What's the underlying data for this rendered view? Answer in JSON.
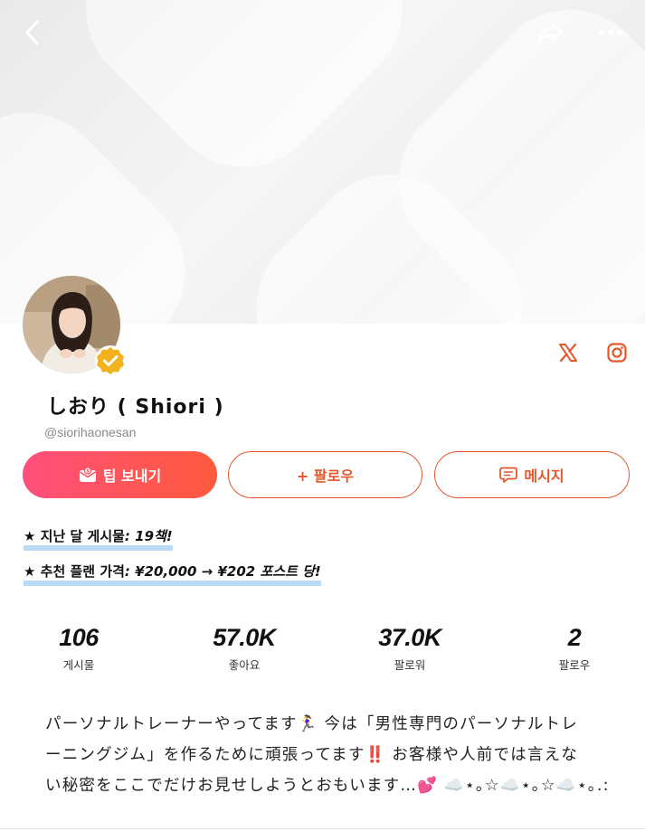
{
  "topbar": {
    "back_icon": "chevron-left-icon",
    "share_icon": "share-icon",
    "more_icon": "more-dots-icon"
  },
  "profile": {
    "name": "しおり ( Shiori )",
    "handle": "@siorihaonesan",
    "verified": true,
    "social": [
      "x-icon",
      "instagram-icon"
    ]
  },
  "actions": {
    "tip": "팁 보내기",
    "follow": "+ 팔로우",
    "message": "메시지"
  },
  "highlights": [
    {
      "prefix": "★ 지난 달 게시물",
      "value": ": 19책!"
    },
    {
      "prefix": "★ 추천 플랜 가격",
      "value": ": ¥20,000 → ¥202 포스트 당!"
    }
  ],
  "stats": [
    {
      "value": "106",
      "label": "게시물"
    },
    {
      "value": "57.0K",
      "label": "좋아요"
    },
    {
      "value": "37.0K",
      "label": "팔로워"
    },
    {
      "value": "2",
      "label": "팔로우"
    }
  ],
  "bio": [
    "パーソナルトレーナーやってます🏃‍♀️ 今は「男性専門のパーソナルトレ",
    "ーニングジム」を作るために頑張ってます‼️ お客様や人前では言えな",
    "い秘密をここでだけお見せしようとおもいます…💕 ☁️⋆｡☆☁️⋆｡☆☁️⋆｡.:"
  ],
  "colors": {
    "accent": "#e2572c",
    "tip_gradient_start": "#ff4f7c",
    "tip_gradient_end": "#ff5a3c",
    "highlight_marker": "#b9d9f4",
    "verified_badge": "#f2b21d"
  }
}
